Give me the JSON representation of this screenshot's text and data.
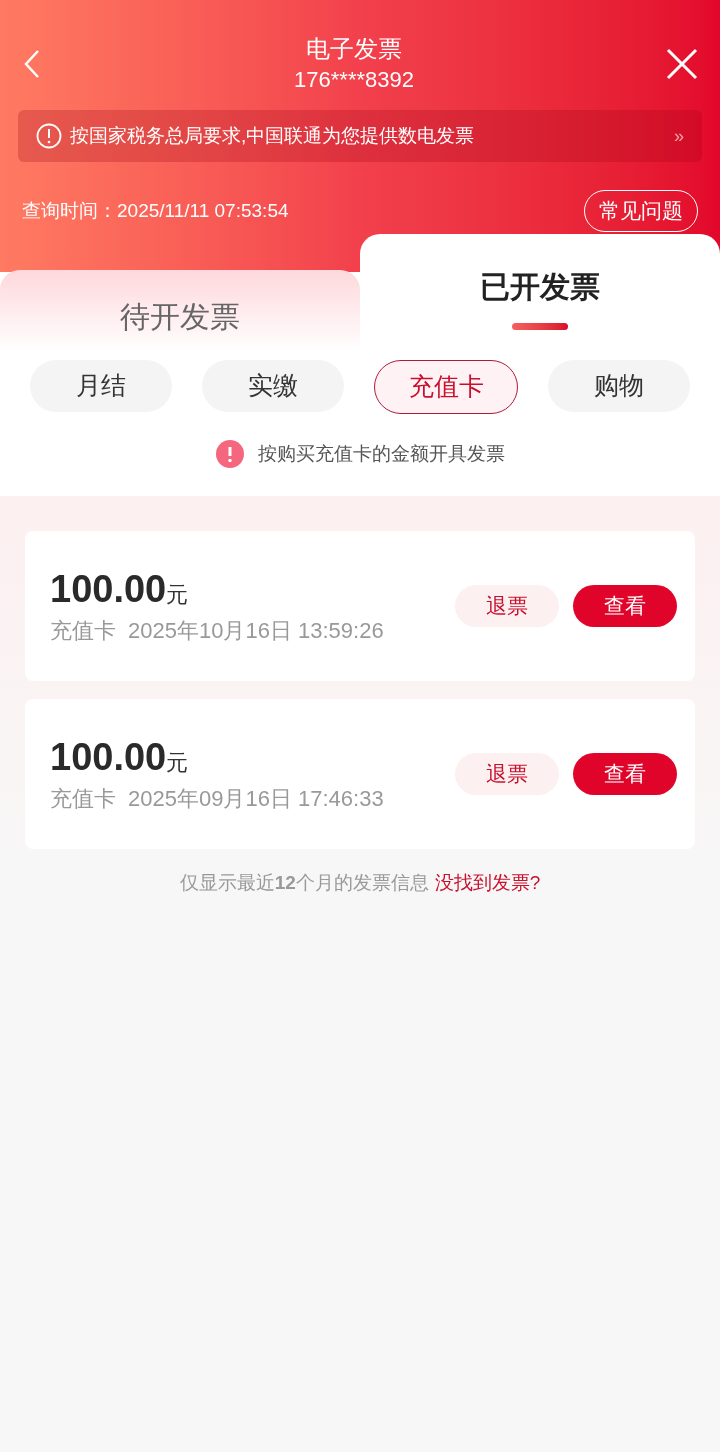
{
  "header": {
    "title": "电子发票",
    "subtitle": "176****8392"
  },
  "notice": {
    "text": "按国家税务总局要求,中国联通为您提供数电发票",
    "arrow": "»"
  },
  "query": {
    "text": "查询时间：2025/11/11 07:53:54",
    "faq_button": "常见问题"
  },
  "tabs": [
    {
      "label": "待开发票",
      "selected": false
    },
    {
      "label": "已开发票",
      "selected": true
    }
  ],
  "filters": [
    {
      "label": "月结",
      "selected": false
    },
    {
      "label": "实缴",
      "selected": false
    },
    {
      "label": "充值卡",
      "selected": true
    },
    {
      "label": "购物",
      "selected": false
    }
  ],
  "hint": "按购买充值卡的金额开具发票",
  "invoices": [
    {
      "amount": "100.00",
      "unit": "元",
      "type": "充值卡",
      "time": "2025年10月16日 13:59:26",
      "refund_button": "退票",
      "view_button": "查看"
    },
    {
      "amount": "100.00",
      "unit": "元",
      "type": "充值卡",
      "time": "2025年09月16日 17:46:33",
      "refund_button": "退票",
      "view_button": "查看"
    }
  ],
  "footer": {
    "note": "仅显示最近**12**个月的发票信息",
    "link": "没找到发票?"
  }
}
